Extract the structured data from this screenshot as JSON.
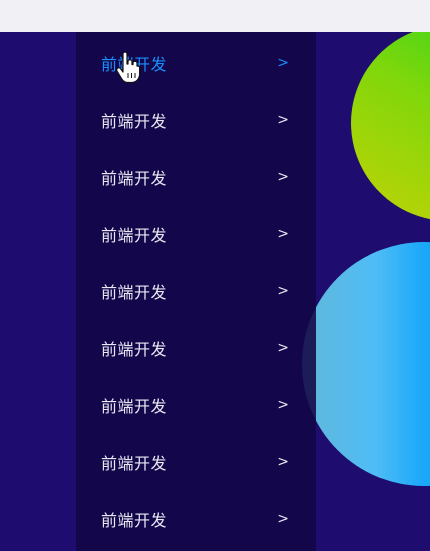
{
  "menu": {
    "items": [
      {
        "label": "前端开发",
        "arrow": ">"
      },
      {
        "label": "前端开发",
        "arrow": ">"
      },
      {
        "label": "前端开发",
        "arrow": ">"
      },
      {
        "label": "前端开发",
        "arrow": ">"
      },
      {
        "label": "前端开发",
        "arrow": ">"
      },
      {
        "label": "前端开发",
        "arrow": ">"
      },
      {
        "label": "前端开发",
        "arrow": ">"
      },
      {
        "label": "前端开发",
        "arrow": ">"
      },
      {
        "label": "前端开发",
        "arrow": ">"
      }
    ],
    "active_index": 0
  },
  "colors": {
    "page_background": "#1e0c6e",
    "menu_background": "#120646",
    "active_text": "#1890ff",
    "text": "#e9e9f4"
  },
  "icons": {
    "cursor": "hand-pointer-icon"
  }
}
